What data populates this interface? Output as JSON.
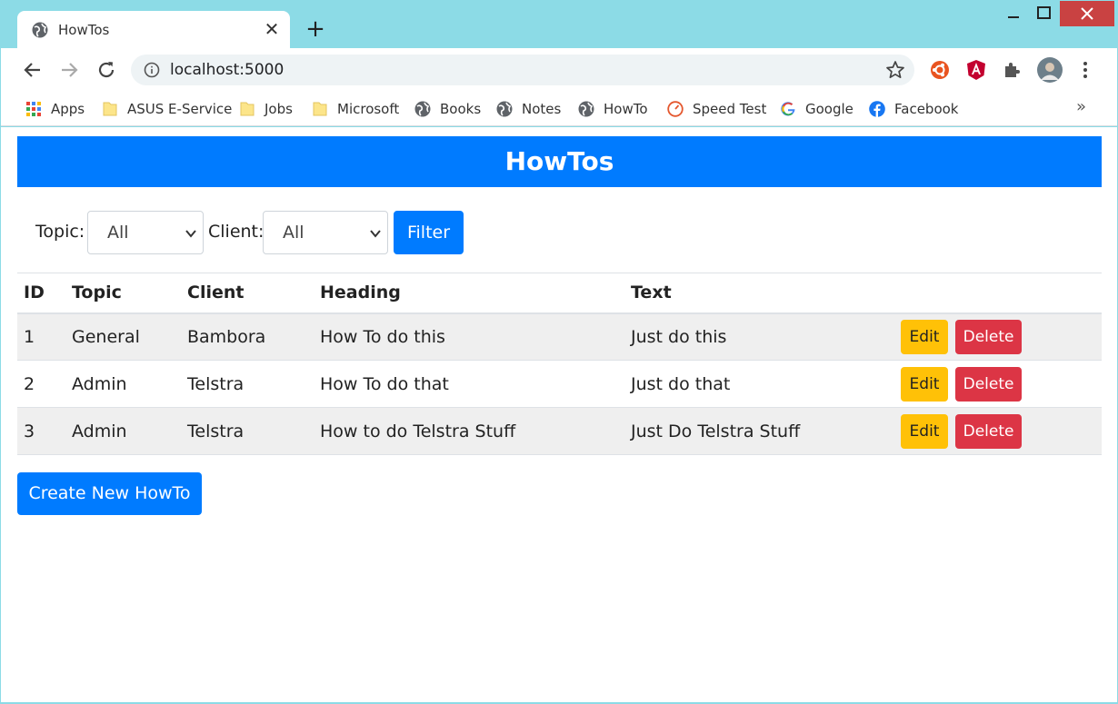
{
  "browser": {
    "tab_title": "HowTos",
    "url": "localhost:5000",
    "bookmarks": [
      {
        "label": "Apps",
        "icon": "apps-grid-icon"
      },
      {
        "label": "ASUS E-Service",
        "icon": "folder-icon"
      },
      {
        "label": "Jobs",
        "icon": "folder-icon"
      },
      {
        "label": "Microsoft",
        "icon": "folder-icon"
      },
      {
        "label": "Books",
        "icon": "globe-icon"
      },
      {
        "label": "Notes",
        "icon": "globe-icon"
      },
      {
        "label": "HowTo",
        "icon": "globe-icon"
      },
      {
        "label": "Speed Test",
        "icon": "speedometer-icon"
      },
      {
        "label": "Google",
        "icon": "google-icon"
      },
      {
        "label": "Facebook",
        "icon": "facebook-icon"
      }
    ],
    "more_bookmarks": "»"
  },
  "page": {
    "banner_title": "HowTos",
    "filter": {
      "topic_label": "Topic:",
      "topic_value": "All",
      "client_label": "Client:",
      "client_value": "All",
      "button_label": "Filter"
    },
    "table": {
      "columns": [
        "ID",
        "Topic",
        "Client",
        "Heading",
        "Text"
      ],
      "rows": [
        {
          "id": "1",
          "topic": "General",
          "client": "Bambora",
          "heading": "How To do this",
          "text": "Just do this"
        },
        {
          "id": "2",
          "topic": "Admin",
          "client": "Telstra",
          "heading": "How To do that",
          "text": "Just do that"
        },
        {
          "id": "3",
          "topic": "Admin",
          "client": "Telstra",
          "heading": "How to do Telstra Stuff",
          "text": "Just Do Telstra Stuff"
        }
      ],
      "edit_label": "Edit",
      "delete_label": "Delete"
    },
    "create_button": "Create New HowTo"
  },
  "colors": {
    "primary": "#007bff",
    "warning": "#ffc107",
    "danger": "#dc3545",
    "window_frame": "#8cdbe6"
  }
}
